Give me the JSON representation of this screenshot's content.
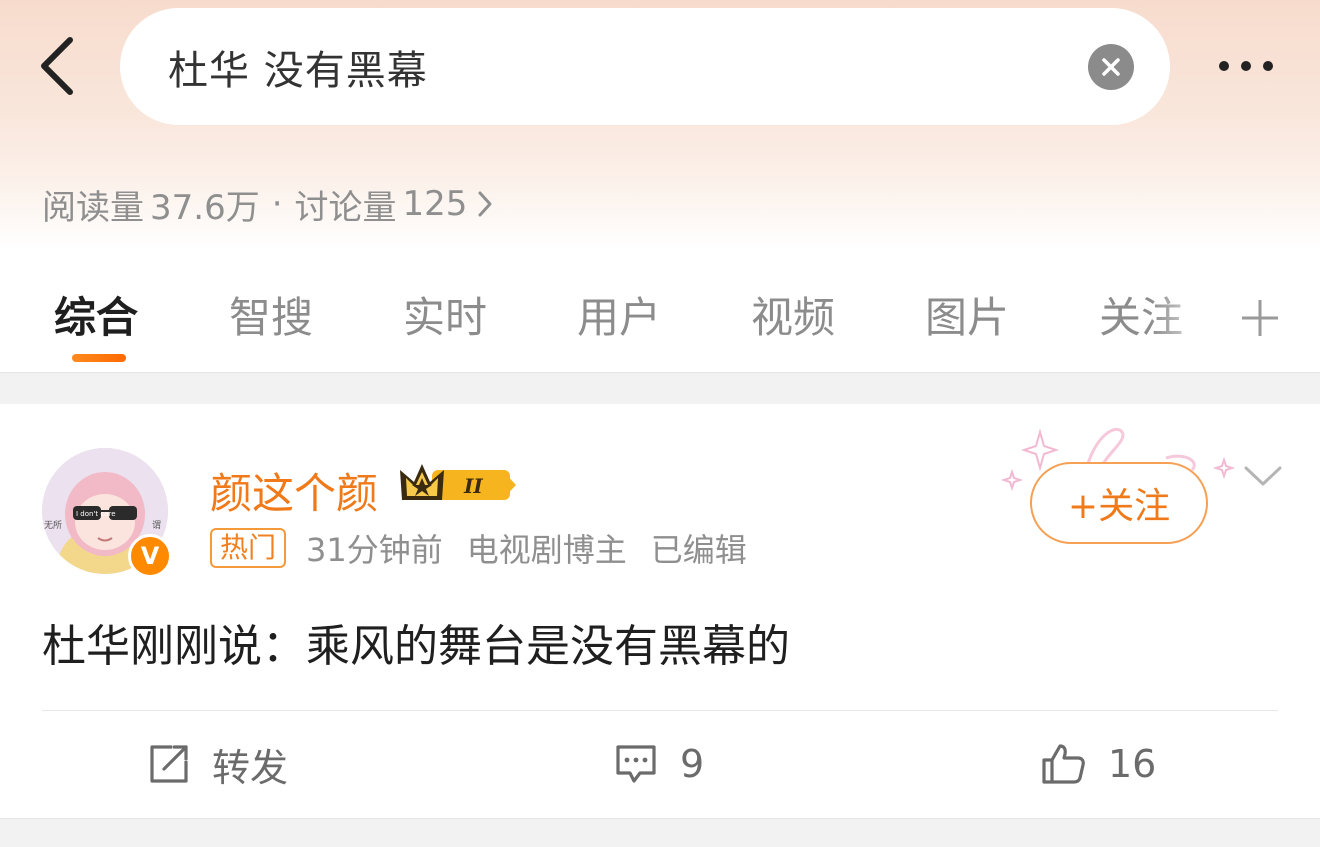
{
  "header": {
    "back_icon": "chevron-left-icon",
    "search_query": "杜华 没有黑幕",
    "clear_icon": "clear-circle-icon",
    "more_icon": "more-dots-icon"
  },
  "stats": {
    "read_label": "阅读量",
    "read_value": "37.6万",
    "separator": "·",
    "discuss_label": "讨论量",
    "discuss_value": "125"
  },
  "tabs": [
    {
      "label": "综合",
      "active": true
    },
    {
      "label": "智搜"
    },
    {
      "label": "实时"
    },
    {
      "label": "用户"
    },
    {
      "label": "视频"
    },
    {
      "label": "图片"
    },
    {
      "label": "关注"
    }
  ],
  "tab_add_icon": "plus-icon",
  "post": {
    "username": "颜这个颜",
    "vip_level": "II",
    "verified_badge": "V",
    "hot_tag": "热门",
    "time": "31分钟前",
    "role": "电视剧博主",
    "edited": "已编辑",
    "follow_label": "+关注",
    "content": "杜华刚刚说：乘风的舞台是没有黑幕的",
    "avatar_text": {
      "glasses": "I don't care",
      "left": "无所",
      "right": "谓"
    },
    "actions": {
      "repost_label": "转发",
      "comment_count": "9",
      "like_count": "16"
    }
  },
  "colors": {
    "accent": "#f07a1a",
    "header_gradient_top": "#f7dccd",
    "text_primary": "#1f1f1f",
    "text_secondary": "#8f8f8f",
    "band": "#f2f2f2"
  }
}
